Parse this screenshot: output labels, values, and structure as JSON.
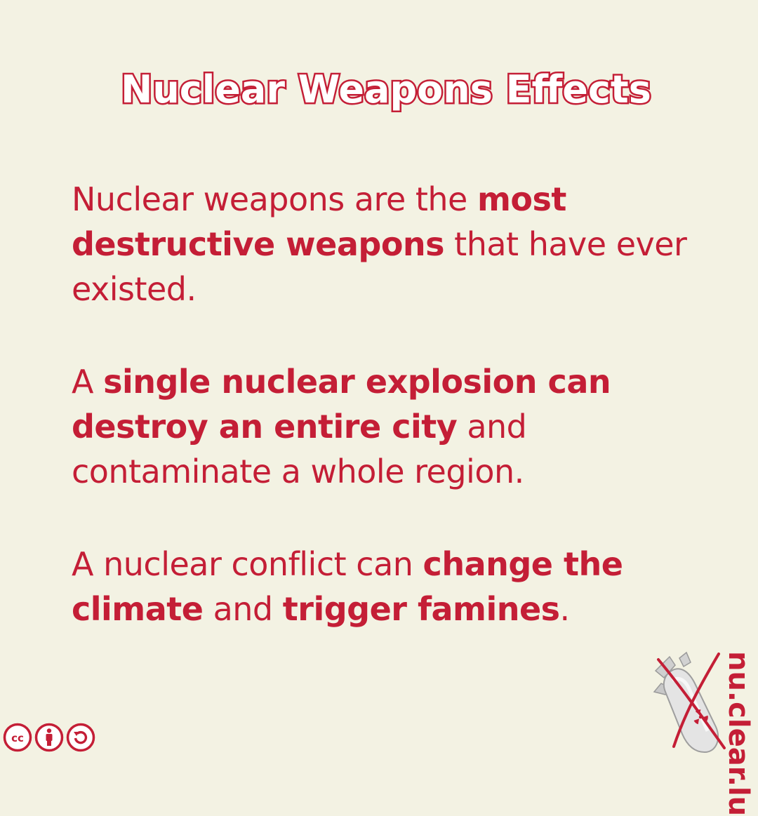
{
  "title": "Nuclear Weapons Effects",
  "paragraphs": [
    [
      {
        "text": "Nuclear weapons are the ",
        "bold": false
      },
      {
        "text": "most destructive weapons",
        "bold": true
      },
      {
        "text": " that have ever existed.",
        "bold": false
      }
    ],
    [
      {
        "text": "A ",
        "bold": false
      },
      {
        "text": "single nuclear explosion can destroy an entire city",
        "bold": true
      },
      {
        "text": " and contaminate a whole region.",
        "bold": false
      }
    ],
    [
      {
        "text": "A nuclear conflict can ",
        "bold": false
      },
      {
        "text": "change the climate",
        "bold": true
      },
      {
        "text": " and ",
        "bold": false
      },
      {
        "text": "trigger famines",
        "bold": true
      },
      {
        "text": ".",
        "bold": false
      }
    ]
  ],
  "brand": "nu.clear.lu",
  "license": {
    "cc_label": "cc",
    "icons": [
      "creative-commons-icon",
      "attribution-icon",
      "share-alike-icon"
    ]
  },
  "colors": {
    "accent": "#c41e36",
    "background": "#f3f2e3",
    "title_fill": "#ffffff"
  }
}
